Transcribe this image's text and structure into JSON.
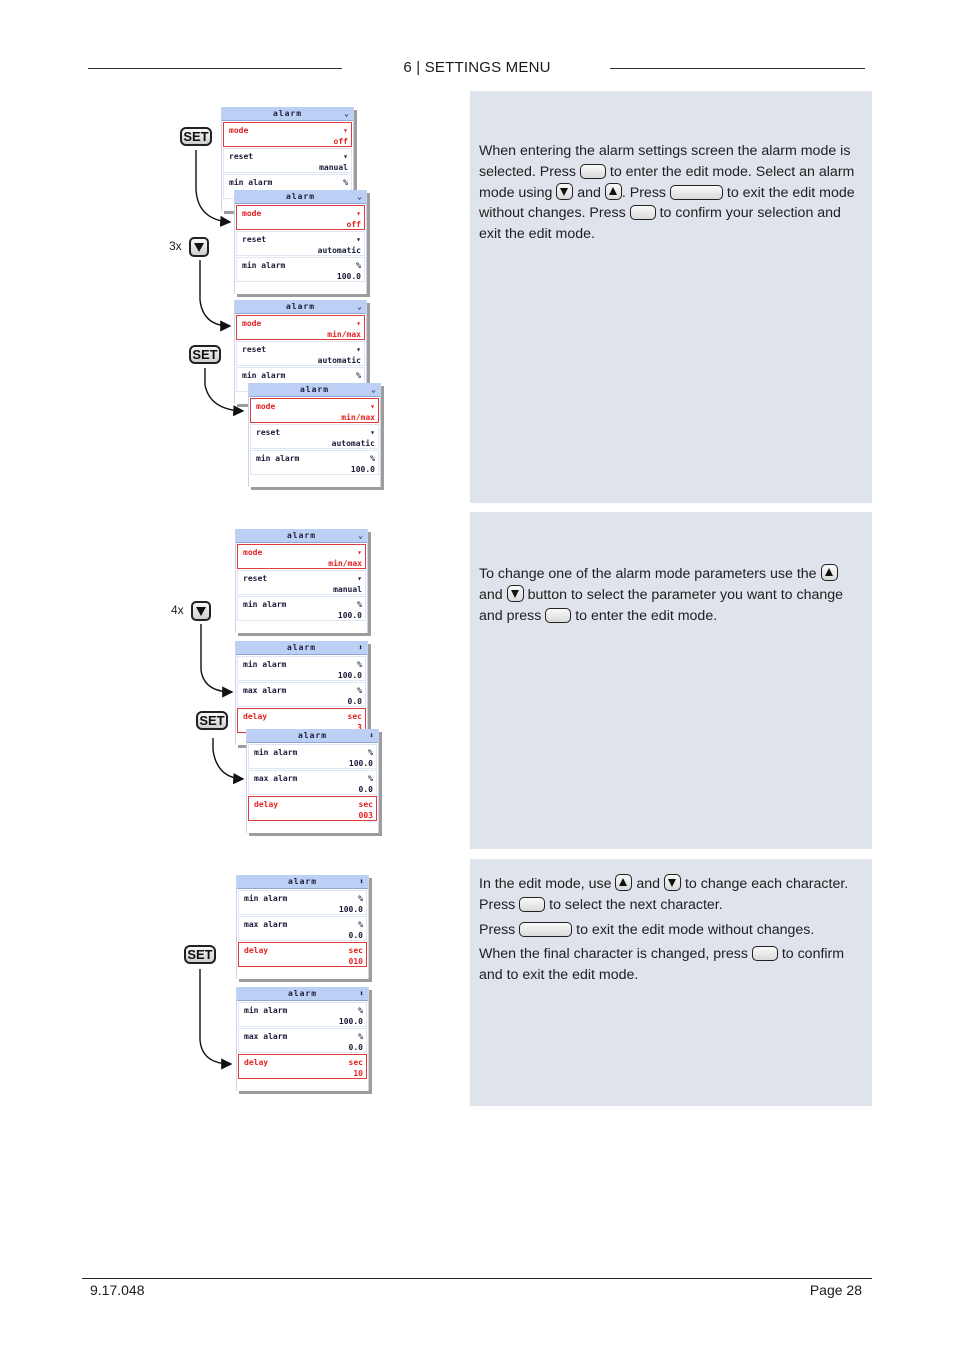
{
  "header": {
    "title": "6 | SETTINGS MENU"
  },
  "footer": {
    "doc_number": "9.17.048",
    "page": "Page 28"
  },
  "buttons": {
    "set_label": "SET"
  },
  "steps": [
    {
      "multipliers": [
        "3x"
      ],
      "paragraphs": [
        [
          "When entering the alarm settings screen the alarm mode is selected. Press ",
          "{ok}",
          " to enter the edit mode. Select an alarm mode using ",
          "{down}",
          " and ",
          "{up}",
          ". Press ",
          "{esc}",
          " to exit the edit mode without changes. Press ",
          "{ok}",
          " to confirm your selection and exit the edit mode."
        ]
      ]
    },
    {
      "multipliers": [
        "4x"
      ],
      "paragraphs": [
        [
          "To change one of the alarm mode parameters use the ",
          "{up}",
          " and ",
          "{down}",
          " button to select the parameter you want to change and press ",
          "{ok}",
          " to enter the edit mode."
        ]
      ]
    },
    {
      "multipliers": [],
      "paragraphs": [
        [
          "In the edit mode, use ",
          "{up}",
          " and ",
          "{down}",
          " to change each character. Press ",
          "{ok}",
          " to select the next character."
        ],
        [
          "Press ",
          "{esc}",
          " to exit the edit mode without changes."
        ],
        [
          "When the final character is changed, press ",
          "{ok}",
          " to confirm and to exit the edit mode."
        ]
      ]
    }
  ],
  "screens": [
    {
      "title": "alarm",
      "indicator": "down",
      "rows": [
        {
          "label": "mode",
          "unit": "▼",
          "value": "off",
          "selected": true
        },
        {
          "label": "reset",
          "unit": "▼",
          "value": "manual",
          "selected": false
        },
        {
          "label": "min alarm",
          "unit": "%",
          "value": "",
          "selected": false
        }
      ]
    },
    {
      "title": "alarm",
      "indicator": "down",
      "rows": [
        {
          "label": "mode",
          "unit": "▼",
          "value": "off",
          "selected": true
        },
        {
          "label": "reset",
          "unit": "▼",
          "value": "automatic",
          "selected": false
        },
        {
          "label": "min alarm",
          "unit": "%",
          "value": "100.0",
          "selected": false
        }
      ]
    },
    {
      "title": "alarm",
      "indicator": "down",
      "rows": [
        {
          "label": "mode",
          "unit": "▼",
          "value": "min/max",
          "selected": true
        },
        {
          "label": "reset",
          "unit": "▼",
          "value": "automatic",
          "selected": false
        },
        {
          "label": "min alarm",
          "unit": "%",
          "value": "",
          "selected": false
        }
      ]
    },
    {
      "title": "alarm",
      "indicator": "down",
      "rows": [
        {
          "label": "mode",
          "unit": "▼",
          "value": "min/max",
          "selected": true
        },
        {
          "label": "reset",
          "unit": "▼",
          "value": "automatic",
          "selected": false
        },
        {
          "label": "min alarm",
          "unit": "%",
          "value": "100.0",
          "selected": false
        }
      ]
    },
    {
      "title": "alarm",
      "indicator": "down",
      "rows": [
        {
          "label": "mode",
          "unit": "▼",
          "value": "min/max",
          "selected": true
        },
        {
          "label": "reset",
          "unit": "▼",
          "value": "manual",
          "selected": false
        },
        {
          "label": "min alarm",
          "unit": "%",
          "value": "100.0",
          "selected": false
        }
      ]
    },
    {
      "title": "alarm",
      "indicator": "updown",
      "rows": [
        {
          "label": "min alarm",
          "unit": "%",
          "value": "100.0",
          "selected": false
        },
        {
          "label": "max alarm",
          "unit": "%",
          "value": "0.0",
          "selected": false
        },
        {
          "label": "delay",
          "unit": "sec",
          "value": "3",
          "selected": true
        }
      ]
    },
    {
      "title": "alarm",
      "indicator": "updown",
      "rows": [
        {
          "label": "min alarm",
          "unit": "%",
          "value": "100.0",
          "selected": false
        },
        {
          "label": "max alarm",
          "unit": "%",
          "value": "0.0",
          "selected": false
        },
        {
          "label": "delay",
          "unit": "sec",
          "value": "003",
          "selected": true
        }
      ]
    },
    {
      "title": "alarm",
      "indicator": "updown",
      "rows": [
        {
          "label": "min alarm",
          "unit": "%",
          "value": "100.0",
          "selected": false
        },
        {
          "label": "max alarm",
          "unit": "%",
          "value": "0.0",
          "selected": false
        },
        {
          "label": "delay",
          "unit": "sec",
          "value": "010",
          "selected": true
        }
      ]
    },
    {
      "title": "alarm",
      "indicator": "updown",
      "rows": [
        {
          "label": "min alarm",
          "unit": "%",
          "value": "100.0",
          "selected": false
        },
        {
          "label": "max alarm",
          "unit": "%",
          "value": "0.0",
          "selected": false
        },
        {
          "label": "delay",
          "unit": "sec",
          "value": "10",
          "selected": true
        }
      ]
    }
  ],
  "indicator_glyphs": {
    "down": "⌄",
    "updown": "⬍"
  }
}
